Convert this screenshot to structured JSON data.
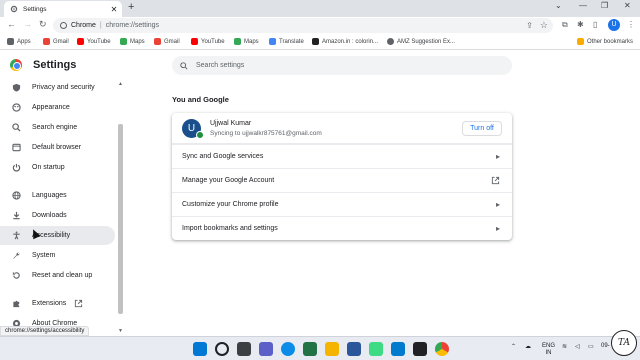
{
  "browser": {
    "tab_title": "Settings",
    "omnibox_site": "Chrome",
    "omnibox_url": "chrome://settings",
    "profile_initial": "U"
  },
  "bookmarks": [
    {
      "label": "Apps",
      "icon": "apps-grid-icon",
      "color": "#5f6368"
    },
    {
      "label": "Gmail",
      "icon": "gmail-icon",
      "color": "#ea4335"
    },
    {
      "label": "YouTube",
      "icon": "youtube-icon",
      "color": "#ff0000"
    },
    {
      "label": "Maps",
      "icon": "maps-icon",
      "color": "#34a853"
    },
    {
      "label": "Gmail",
      "icon": "gmail-icon",
      "color": "#ea4335"
    },
    {
      "label": "YouTube",
      "icon": "youtube-icon",
      "color": "#ff0000"
    },
    {
      "label": "Maps",
      "icon": "maps-icon",
      "color": "#34a853"
    },
    {
      "label": "Translate",
      "icon": "translate-icon",
      "color": "#4285f4"
    },
    {
      "label": "Amazon.in : colorin...",
      "icon": "amazon-icon",
      "color": "#222222"
    },
    {
      "label": "AMZ Suggestion Ex...",
      "icon": "globe-icon",
      "color": "#5f6368"
    }
  ],
  "other_bookmarks": "Other bookmarks",
  "settings": {
    "title": "Settings",
    "search_placeholder": "Search settings",
    "sidebar": [
      {
        "label": "Privacy and security",
        "icon": "shield-icon"
      },
      {
        "label": "Appearance",
        "icon": "palette-icon"
      },
      {
        "label": "Search engine",
        "icon": "search-icon"
      },
      {
        "label": "Default browser",
        "icon": "browser-icon"
      },
      {
        "label": "On startup",
        "icon": "power-icon"
      },
      {
        "label": "Languages",
        "icon": "globe-icon"
      },
      {
        "label": "Downloads",
        "icon": "download-icon"
      },
      {
        "label": "Accessibility",
        "icon": "accessibility-icon"
      },
      {
        "label": "System",
        "icon": "wrench-icon"
      },
      {
        "label": "Reset and clean up",
        "icon": "reset-icon"
      },
      {
        "label": "Extensions",
        "icon": "puzzle-icon"
      },
      {
        "label": "About Chrome",
        "icon": "chrome-icon"
      }
    ],
    "section_title": "You and Google",
    "account": {
      "initial": "U",
      "name": "Ujjwal Kumar",
      "sync_text": "Syncing to ujjwalkr875761@gmail.com",
      "turn_off": "Turn off"
    },
    "rows": [
      {
        "label": "Sync and Google services",
        "icon": "arrow-right-icon"
      },
      {
        "label": "Manage your Google Account",
        "icon": "open-external-icon"
      },
      {
        "label": "Customize your Chrome profile",
        "icon": "arrow-right-icon"
      },
      {
        "label": "Import bookmarks and settings",
        "icon": "arrow-right-icon"
      }
    ]
  },
  "status_url": "chrome://settings/accessibility",
  "taskbar": {
    "lang_top": "ENG",
    "lang_bottom": "IN",
    "time_partial": "09-",
    "watermark": "TA"
  }
}
